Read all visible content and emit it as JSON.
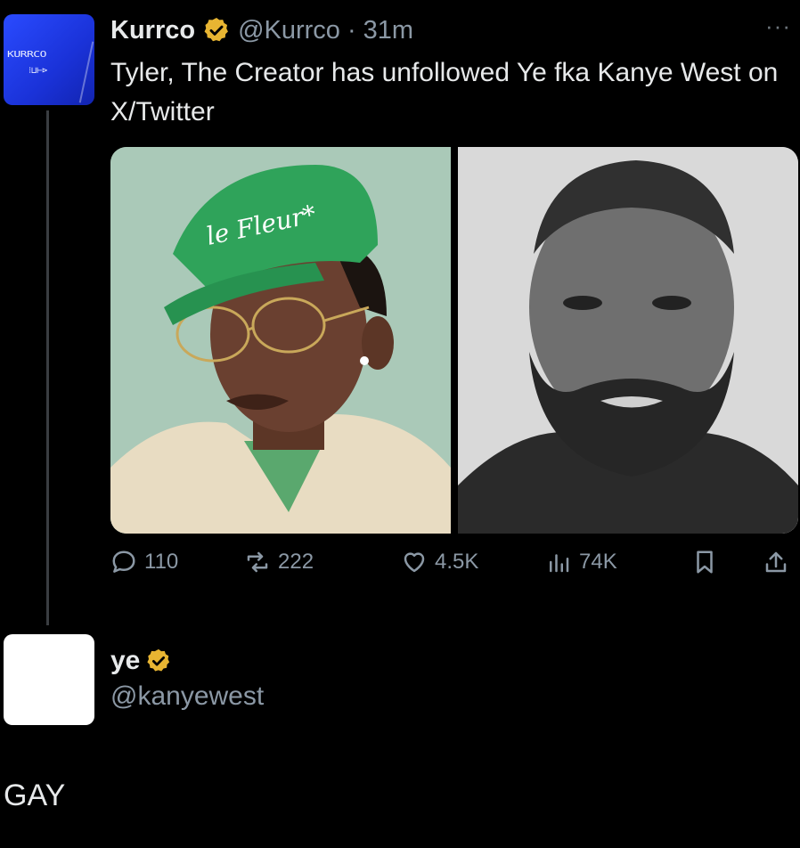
{
  "tweet": {
    "avatar_logo_text": "KURRCO",
    "avatar_logo_sub": "⁝⊔⊢⊳",
    "display_name": "Kurrco",
    "handle": "@Kurrco",
    "separator": "·",
    "time": "31m",
    "more": "···",
    "text": "Tyler, The Creator has unfollowed Ye fka Kanye West on X/Twitter",
    "images": [
      {
        "cap_text": "le Fleur*",
        "palette": {
          "bg": "#aac9b8",
          "cap": "#2fa35a",
          "skin": "#6a4030",
          "coat": "#e8dcc2"
        }
      },
      {
        "palette": {
          "bg": "#d9d9d9",
          "skin": "#6f6f6f",
          "shirt": "#2a2a2a",
          "beard": "#262626"
        }
      }
    ],
    "actions": {
      "replies": "110",
      "reposts": "222",
      "likes": "4.5K",
      "views": "74K"
    }
  },
  "reply_card": {
    "display_name": "ye",
    "handle": "@kanyewest",
    "body": "GAY"
  },
  "colors": {
    "background": "#000000",
    "text": "#e7e9ea",
    "secondary": "#8b98a5",
    "verified_gold": "#e8b532",
    "kurrco_blue": "#1f3ae0"
  }
}
